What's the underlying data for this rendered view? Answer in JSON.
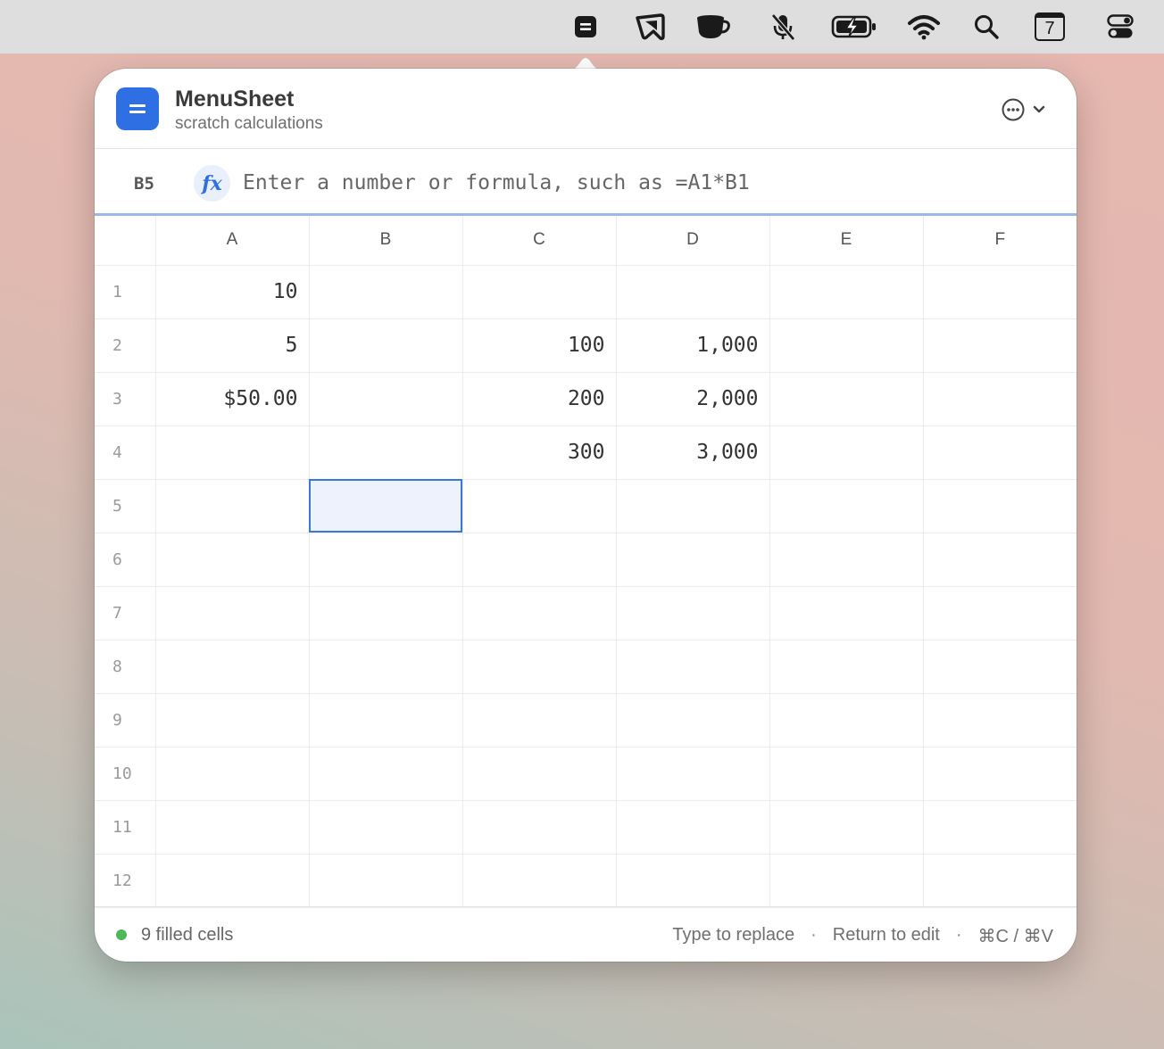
{
  "menubar": {
    "icons": [
      "menusheet-icon",
      "bookmark-icon",
      "coffee-cup-icon",
      "muted-microphone-icon",
      "battery-charging-icon",
      "wifi-icon",
      "search-icon",
      "calendar-icon",
      "control-center-icon"
    ],
    "calendar_day": "7"
  },
  "app": {
    "title": "MenuSheet",
    "subtitle": "scratch calculations",
    "logo_glyph": "=",
    "accent": "#2f6fe4"
  },
  "formula": {
    "cell_ref": "B5",
    "fx_label": "fx",
    "placeholder": "Enter a number or formula, such as =A1*B1",
    "value": ""
  },
  "sheet": {
    "columns": [
      "A",
      "B",
      "C",
      "D",
      "E",
      "F"
    ],
    "rows": [
      {
        "label": "1",
        "cells": [
          "10",
          "",
          "",
          "",
          "",
          ""
        ]
      },
      {
        "label": "2",
        "cells": [
          "5",
          "",
          "100",
          "1,000",
          "",
          ""
        ]
      },
      {
        "label": "3",
        "cells": [
          "$50.00",
          "",
          "200",
          "2,000",
          "",
          ""
        ]
      },
      {
        "label": "4",
        "cells": [
          "",
          "",
          "300",
          "3,000",
          "",
          ""
        ]
      },
      {
        "label": "5",
        "cells": [
          "",
          "",
          "",
          "",
          "",
          ""
        ]
      },
      {
        "label": "6",
        "cells": [
          "",
          "",
          "",
          "",
          "",
          ""
        ]
      },
      {
        "label": "7",
        "cells": [
          "",
          "",
          "",
          "",
          "",
          ""
        ]
      },
      {
        "label": "8",
        "cells": [
          "",
          "",
          "",
          "",
          "",
          ""
        ]
      },
      {
        "label": "9",
        "cells": [
          "",
          "",
          "",
          "",
          "",
          ""
        ]
      },
      {
        "label": "10",
        "cells": [
          "",
          "",
          "",
          "",
          "",
          ""
        ]
      },
      {
        "label": "11",
        "cells": [
          "",
          "",
          "",
          "",
          "",
          ""
        ]
      },
      {
        "label": "12",
        "cells": [
          "",
          "",
          "",
          "",
          "",
          ""
        ]
      }
    ],
    "selected": {
      "row": 4,
      "col": 1
    }
  },
  "footer": {
    "status": "9 filled cells",
    "status_color": "#4cb85a",
    "hints": [
      "Type to replace",
      "Return to edit",
      "⌘C / ⌘V"
    ],
    "separator": "·"
  }
}
